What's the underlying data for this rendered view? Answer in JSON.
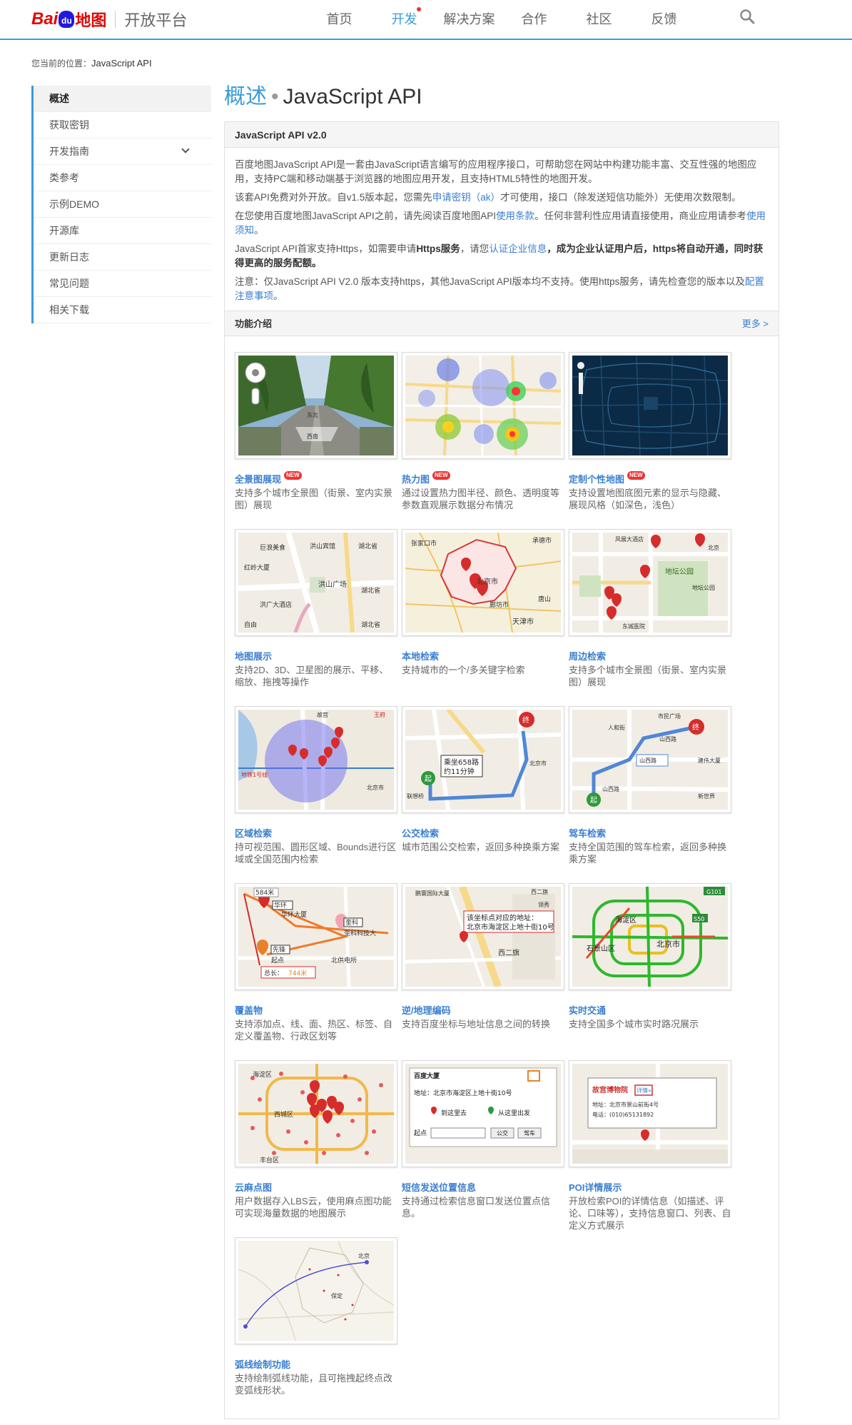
{
  "header": {
    "logo_bai": "Bai",
    "logo_du": "du",
    "logo_map": "地图",
    "platform": "开放平台",
    "nav": [
      {
        "label": "首页",
        "active": false
      },
      {
        "label": "开发",
        "active": true
      },
      {
        "label": "解决方案",
        "active": false
      },
      {
        "label": "合作",
        "active": false
      },
      {
        "label": "社区",
        "active": false
      },
      {
        "label": "反馈",
        "active": false
      }
    ]
  },
  "breadcrumb": {
    "label": "您当前的位置：",
    "current": "JavaScript API"
  },
  "sidebar": {
    "items": [
      {
        "label": "概述"
      },
      {
        "label": "获取密钥"
      },
      {
        "label": "开发指南"
      },
      {
        "label": "类参考"
      },
      {
        "label": "示例DEMO"
      },
      {
        "label": "开源库"
      },
      {
        "label": "更新日志"
      },
      {
        "label": "常见问题"
      },
      {
        "label": "相关下载"
      }
    ]
  },
  "page": {
    "title_main": "概述",
    "title_dot": "•",
    "title_sub": "JavaScript API",
    "box_title": "JavaScript API v2.0",
    "intro": {
      "p1": "百度地图JavaScript API是一套由JavaScript语言编写的应用程序接口，可帮助您在网站中构建功能丰富、交互性强的地图应用，支持PC端和移动端基于浏览器的地图应用开发，且支持HTML5特性的地图开发。",
      "p2_a": "该套API免费对外开放。自v1.5版本起，您需先",
      "p2_link": "申请密钥（ak）",
      "p2_b": "才可使用，接口（除发送短信功能外）无使用次数限制。",
      "p3_a": "在您使用百度地图JavaScript API之前，请先阅读百度地图API",
      "p3_link1": "使用条款",
      "p3_b": "。任何非营利性应用请直接使用，商业应用请参考",
      "p3_link2": "使用须知",
      "p3_c": "。",
      "p4_a": "JavaScript API首家支持Https，如需要申请",
      "p4_bold1": "Https服务",
      "p4_b": "，请您",
      "p4_link": "认证企业信息",
      "p4_bold2": "，成为企业认证用户后，https将自动开通，同时获得更高的服务配额。",
      "p5_a": "注意：仅JavaScript API V2.0 版本支持https，其他JavaScript API版本均不支持。使用https服务，请先检查您的版本以及",
      "p5_link": "配置注意事项",
      "p5_b": "。"
    },
    "features_title": "功能介绍",
    "more_label": "更多 >"
  },
  "features": [
    {
      "title": "全景图展现",
      "new": "NEW",
      "desc": "支持多个城市全景图（街景、室内实景图）展现"
    },
    {
      "title": "热力图",
      "new": "NEW",
      "desc": "通过设置热力图半径、颜色、透明度等参数直观展示数据分布情况"
    },
    {
      "title": "定制个性地图",
      "new": "NEW",
      "desc": "支持设置地图底图元素的显示与隐藏、展现风格（如深色，浅色）"
    },
    {
      "title": "地图展示",
      "new": "",
      "desc": "支持2D、3D、卫星图的展示、平移、缩放、拖拽等操作"
    },
    {
      "title": "本地检索",
      "new": "",
      "desc": "支持城市的一个/多关键字检索"
    },
    {
      "title": "周边检索",
      "new": "",
      "desc": "支持多个城市全景图（街景、室内实景图）展现"
    },
    {
      "title": "区域检索",
      "new": "",
      "desc": "持可视范围、圆形区域、Bounds进行区域或全国范围内检索"
    },
    {
      "title": "公交检索",
      "new": "",
      "desc": "城市范围公交检索，返回多种换乘方案"
    },
    {
      "title": "驾车检索",
      "new": "",
      "desc": "支持全国范围的驾车检索，返回多种换乘方案"
    },
    {
      "title": "覆盖物",
      "new": "",
      "desc": "支持添加点、线、面、热区、标签、自定义覆盖物、行政区划等"
    },
    {
      "title": "逆/地理编码",
      "new": "",
      "desc": "支持百度坐标与地址信息之间的转换"
    },
    {
      "title": "实时交通",
      "new": "",
      "desc": "支持全国多个城市实时路况展示"
    },
    {
      "title": "云麻点图",
      "new": "",
      "desc": "用户数据存入LBS云，使用麻点图功能可实现海量数据的地图展示"
    },
    {
      "title": "短信发送位置信息",
      "new": "",
      "desc": "支持通过检索信息窗口发送位置点信息。"
    },
    {
      "title": "POI详情展示",
      "new": "",
      "desc": "开放检索POI的详情信息（如描述、评论、口味等），支持信息窗口、列表、自定义方式展示"
    },
    {
      "title": "弧线绘制功能",
      "new": "",
      "desc": "支持绘制弧线功能，且可拖拽起终点改变弧线形状。"
    }
  ],
  "thumb_text": {
    "pano_east": "东北",
    "pano_west": "西南",
    "map_labels": [
      "巨浪美食",
      "洪山宾馆",
      "湖北省",
      "红岭大厦",
      "洪山广场",
      "洪广大酒店",
      "湖北省",
      "自由",
      "湖北省"
    ],
    "local_labels": [
      "张家口市",
      "承德市",
      "北京市",
      "廊坊市",
      "唐山",
      "天津市"
    ],
    "nearby_labels": [
      "凤展大酒店",
      "北京",
      "地坛公园",
      "地坛公园",
      "东城医院"
    ],
    "area_labels": [
      "故宫",
      "王府",
      "地铁1号线",
      "北京市"
    ],
    "bus_box1": "乘坐658路",
    "bus_box2": "约11分钟",
    "bus_start": "起",
    "bus_end": "终",
    "bus_labels": [
      "北京市",
      "联想桥"
    ],
    "drive_labels": [
      "市民广场",
      "人和街",
      "山西路",
      "山西路",
      "建伟大厦",
      "山西路",
      "新世界"
    ],
    "drive_start": "起",
    "drive_end": "终",
    "overlay_labels": [
      "584米",
      "华环",
      "华环大厦",
      "奎科",
      "奎科科技大",
      "先锋",
      "起点",
      "北供电所"
    ],
    "overlay_total": "总长：",
    "overlay_len": "744米",
    "geo_box1": "该坐标点对应的地址：",
    "geo_box2": "北京市海淀区上地十街10号",
    "geo_labels": [
      "西二旗",
      "鹏寰国际大厦",
      "领秀",
      "西二旗"
    ],
    "traffic_labels": [
      "海淀区",
      "北京市",
      "石景山区",
      "G101",
      "S50"
    ],
    "cloud_labels": [
      "西城区",
      "海淀区",
      "丰台区"
    ],
    "sms_title": "百度大厦",
    "sms_addr": "地址：北京市海淀区上地十街10号",
    "sms_go": "到这里去",
    "sms_from": "从这里出发",
    "sms_start": "起点",
    "sms_bus": "公交",
    "sms_car": "驾车",
    "poi_title": "故宫博物院",
    "poi_more": "详情»",
    "poi_addr": "地址：北京市景山前街4号",
    "poi_tel": "电话：(010)65131892",
    "arc_labels": [
      "北京",
      "保定"
    ]
  },
  "colors": {
    "accent": "#3a9bd8",
    "link": "#3a7fd0",
    "red": "#e10602"
  }
}
